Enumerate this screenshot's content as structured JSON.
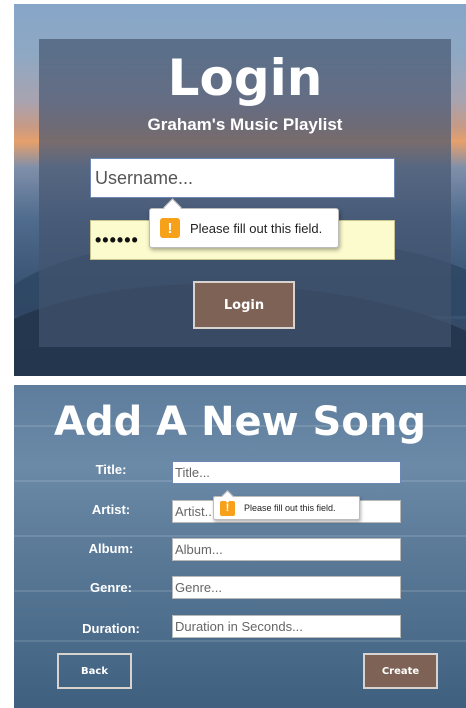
{
  "login": {
    "title": "Login",
    "subtitle": "Graham's Music Playlist",
    "username_placeholder": "Username...",
    "password_value": "••••••",
    "tooltip_text": "Please fill out this field.",
    "tooltip_icon": "warning-icon",
    "button_label": "Login"
  },
  "add_song": {
    "title": "Add A New Song",
    "fields": [
      {
        "label": "Title:",
        "placeholder": "Title..."
      },
      {
        "label": "Artist:",
        "placeholder": "Artist..."
      },
      {
        "label": "Album:",
        "placeholder": "Album..."
      },
      {
        "label": "Genre:",
        "placeholder": "Genre..."
      },
      {
        "label": "Duration:",
        "placeholder": "Duration in Seconds..."
      }
    ],
    "tooltip_text": "Please fill out this field.",
    "tooltip_icon": "warning-icon",
    "back_label": "Back",
    "create_label": "Create"
  },
  "colors": {
    "button_brown": "#7e6255",
    "warning_orange": "#f7a11b",
    "autofill_yellow": "#fbfbcd"
  }
}
